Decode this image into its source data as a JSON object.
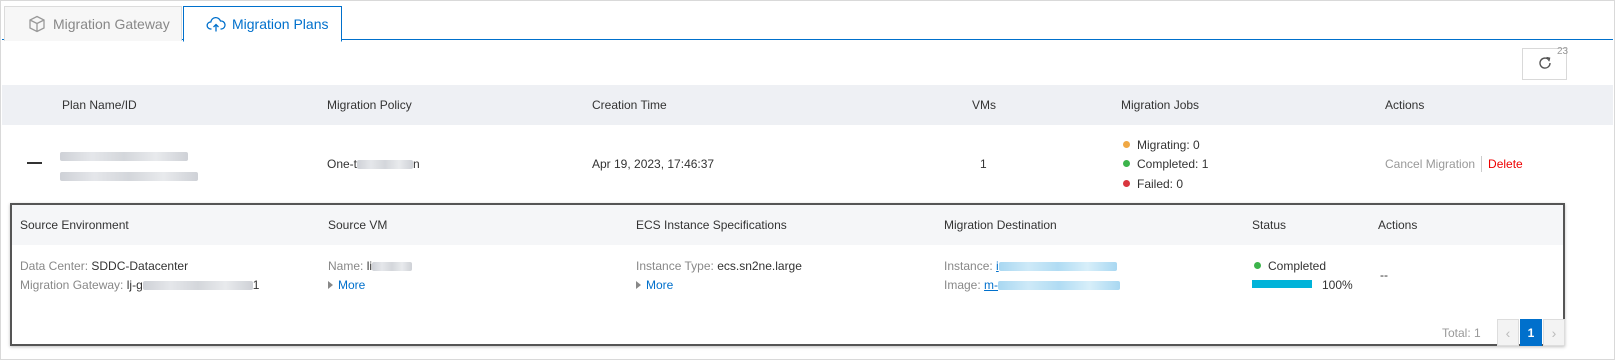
{
  "tabs": [
    {
      "label": "Migration Gateway",
      "icon": "cube-icon",
      "active": false
    },
    {
      "label": "Migration Plans",
      "icon": "cloud-upload-icon",
      "active": true
    }
  ],
  "toolbar": {
    "refresh_icon": "refresh-icon",
    "badge": "23"
  },
  "plans_table": {
    "headers": [
      "Plan Name/ID",
      "Migration Policy",
      "Creation Time",
      "VMs",
      "Migration Jobs",
      "Actions"
    ],
    "row": {
      "policy_prefix": "One-t",
      "policy_suffix": "n",
      "creation_time": "Apr 19, 2023, 17:46:37",
      "vms": "1",
      "jobs": {
        "migrating": "Migrating: 0",
        "completed": "Completed: 1",
        "failed": "Failed: 0"
      },
      "actions": {
        "cancel": "Cancel Migration",
        "delete": "Delete"
      }
    }
  },
  "job_table": {
    "headers": [
      "Source Environment",
      "Source VM",
      "ECS Instance Specifications",
      "Migration Destination",
      "Status",
      "Actions"
    ],
    "row": {
      "dc_label": "Data Center:",
      "dc_value": "SDDC-Datacenter",
      "gw_label": "Migration Gateway:",
      "gw_prefix": "lj-g",
      "gw_suffix": "1",
      "vm_label": "Name:",
      "vm_prefix": "li",
      "vm_more": "More",
      "type_label": "Instance Type:",
      "type_value": "ecs.sn2ne.large",
      "type_more": "More",
      "instance_label": "Instance:",
      "instance_prefix": "i",
      "image_label": "Image:",
      "image_prefix": "m-",
      "status": "Completed",
      "progress_percent": "100%",
      "progress_fraction": 1.0,
      "actions": "--"
    },
    "pagination": {
      "total": "Total: 1",
      "current": "1",
      "prev": "‹",
      "next": "›"
    }
  },
  "colors": {
    "accent": "#0070cc",
    "migrating": "#f0a844",
    "completed": "#3cb44b",
    "failed": "#d9363e",
    "delete": "#e00000",
    "progress": "#00b3d9"
  }
}
